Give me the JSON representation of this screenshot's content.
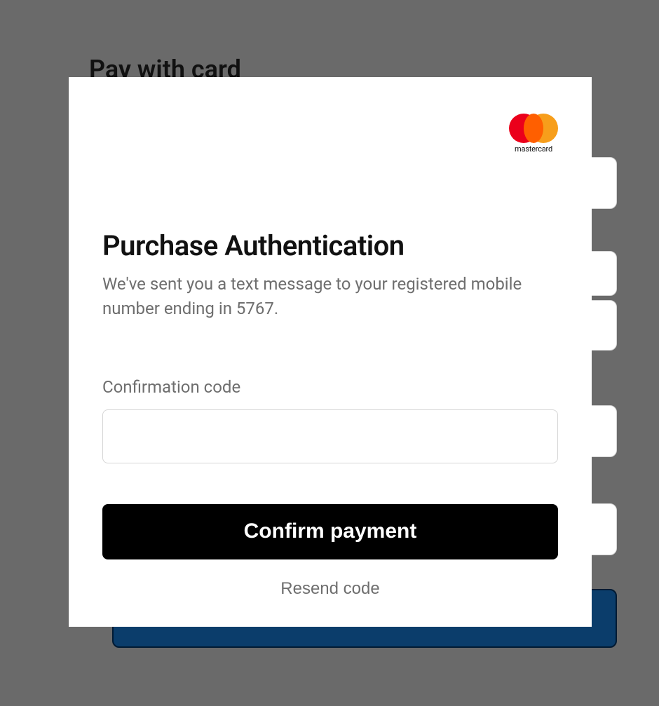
{
  "background": {
    "header": "Pay with card"
  },
  "brand": {
    "icon": "mastercard-icon",
    "label": "mastercard"
  },
  "modal": {
    "title": "Purchase Authentication",
    "description_prefix": "We've sent you a text message to your registered mobile number ending in ",
    "phone_last4": "5767",
    "description_suffix": ".",
    "field_label": "Confirmation code",
    "code_value": "",
    "confirm_label": "Confirm payment",
    "resend_label": "Resend code"
  }
}
